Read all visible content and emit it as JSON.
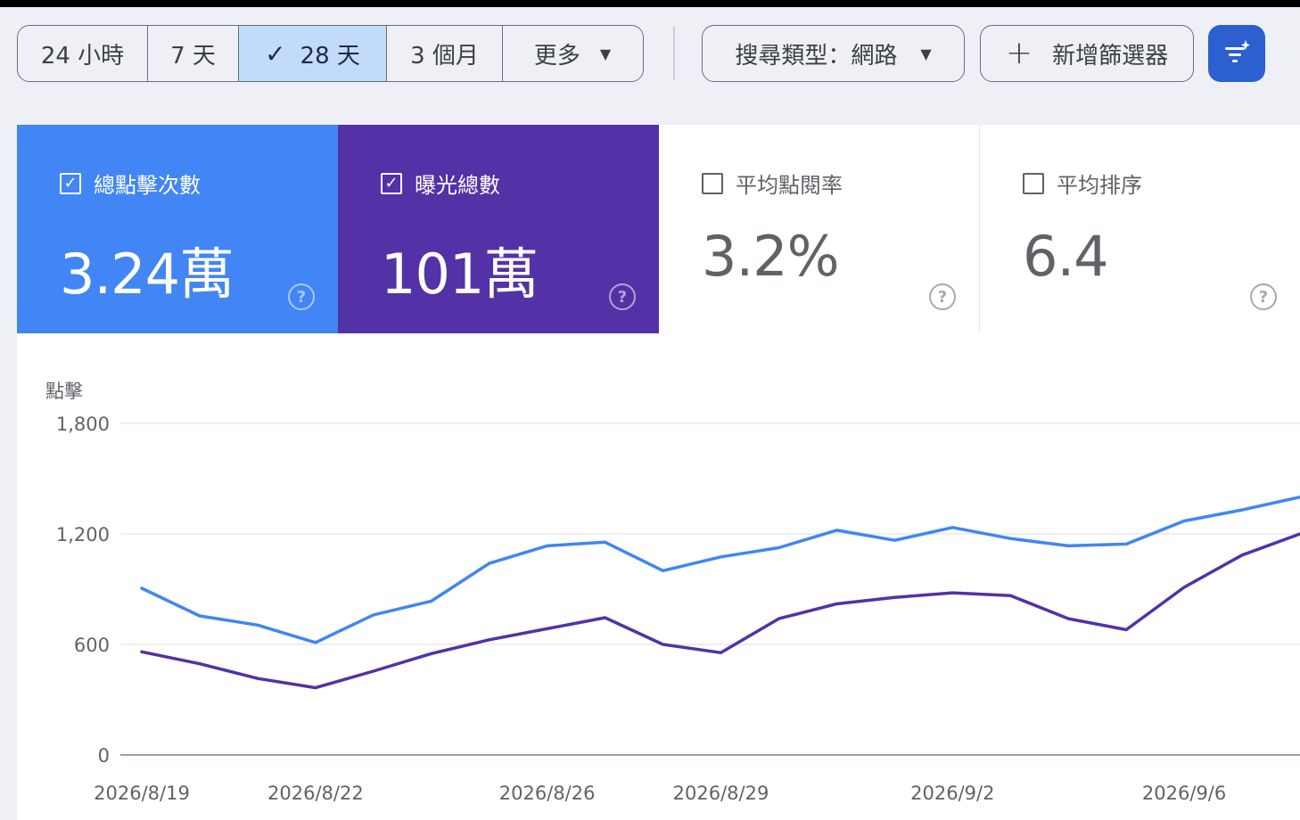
{
  "toolbar": {
    "date_ranges": [
      "24 小時",
      "7 天",
      "28 天",
      "3 個月",
      "更多"
    ],
    "active_range": "28 天",
    "search_type": "搜尋類型：網路",
    "add_filter": "新增篩選器"
  },
  "metrics": [
    {
      "label": "總點擊次數",
      "value": "3.24萬",
      "checked": true,
      "color": "#4285f4"
    },
    {
      "label": "曝光總數",
      "value": "101萬",
      "checked": true,
      "color": "#5232a6"
    },
    {
      "label": "平均點閱率",
      "value": "3.2%",
      "checked": false
    },
    {
      "label": "平均排序",
      "value": "6.4",
      "checked": false
    }
  ],
  "chart_data": {
    "type": "line",
    "ylabel": "點擊",
    "ylim": [
      0,
      1800
    ],
    "y_ticks": [
      "1,800",
      "1,200",
      "600",
      "0"
    ],
    "x": [
      "2026/8/19",
      "2026/8/20",
      "2026/8/21",
      "2026/8/22",
      "2026/8/23",
      "2026/8/24",
      "2026/8/25",
      "2026/8/26",
      "2026/8/27",
      "2026/8/28",
      "2026/8/29",
      "2026/8/30",
      "2026/8/31",
      "2026/9/1",
      "2026/9/2",
      "2026/9/3",
      "2026/9/4",
      "2026/9/5",
      "2026/9/6",
      "2026/9/7",
      "2026/9/8"
    ],
    "x_tick_labels": [
      "2026/8/19",
      "2026/8/22",
      "2026/8/26",
      "2026/8/29",
      "2026/9/2",
      "2026/9/6"
    ],
    "series": [
      {
        "color": "#4285f4",
        "values": [
          905,
          755,
          705,
          610,
          760,
          835,
          1040,
          1135,
          1155,
          1000,
          1075,
          1125,
          1220,
          1165,
          1235,
          1175,
          1135,
          1145,
          1270,
          1330,
          1400
        ]
      },
      {
        "color": "#5232a6",
        "values": [
          560,
          495,
          415,
          365,
          455,
          550,
          625,
          685,
          745,
          600,
          555,
          740,
          820,
          855,
          880,
          865,
          740,
          680,
          910,
          1085,
          1200
        ]
      }
    ]
  }
}
